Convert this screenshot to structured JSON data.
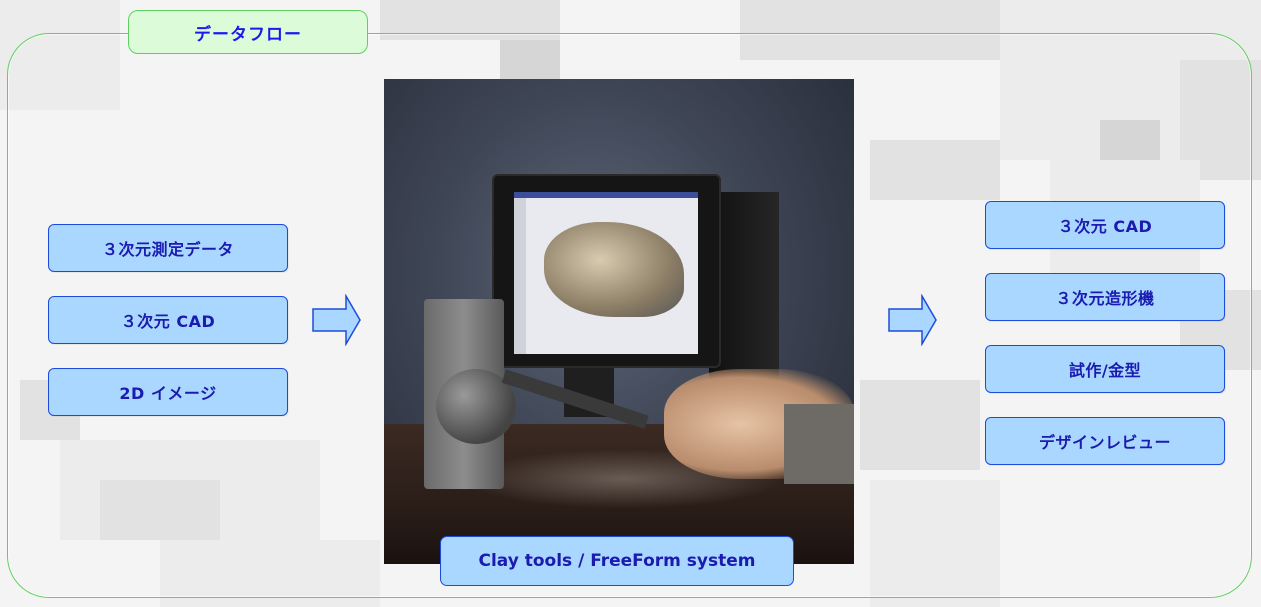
{
  "title": "データフロー",
  "inputs": [
    "３次元測定データ",
    "３次元 CAD",
    "2D イメージ"
  ],
  "outputs": [
    "３次元 CAD",
    "３次元造形機",
    "試作/金型",
    "デザインレビュー"
  ],
  "center_caption": "Clay tools / FreeForm system",
  "colors": {
    "frame_border": "#5fd05f",
    "title_bg": "#dcfbd8",
    "title_text": "#1a1af0",
    "box_bg": "#aad7ff",
    "box_border": "#1d4cdc",
    "box_text": "#1b1bb0"
  }
}
